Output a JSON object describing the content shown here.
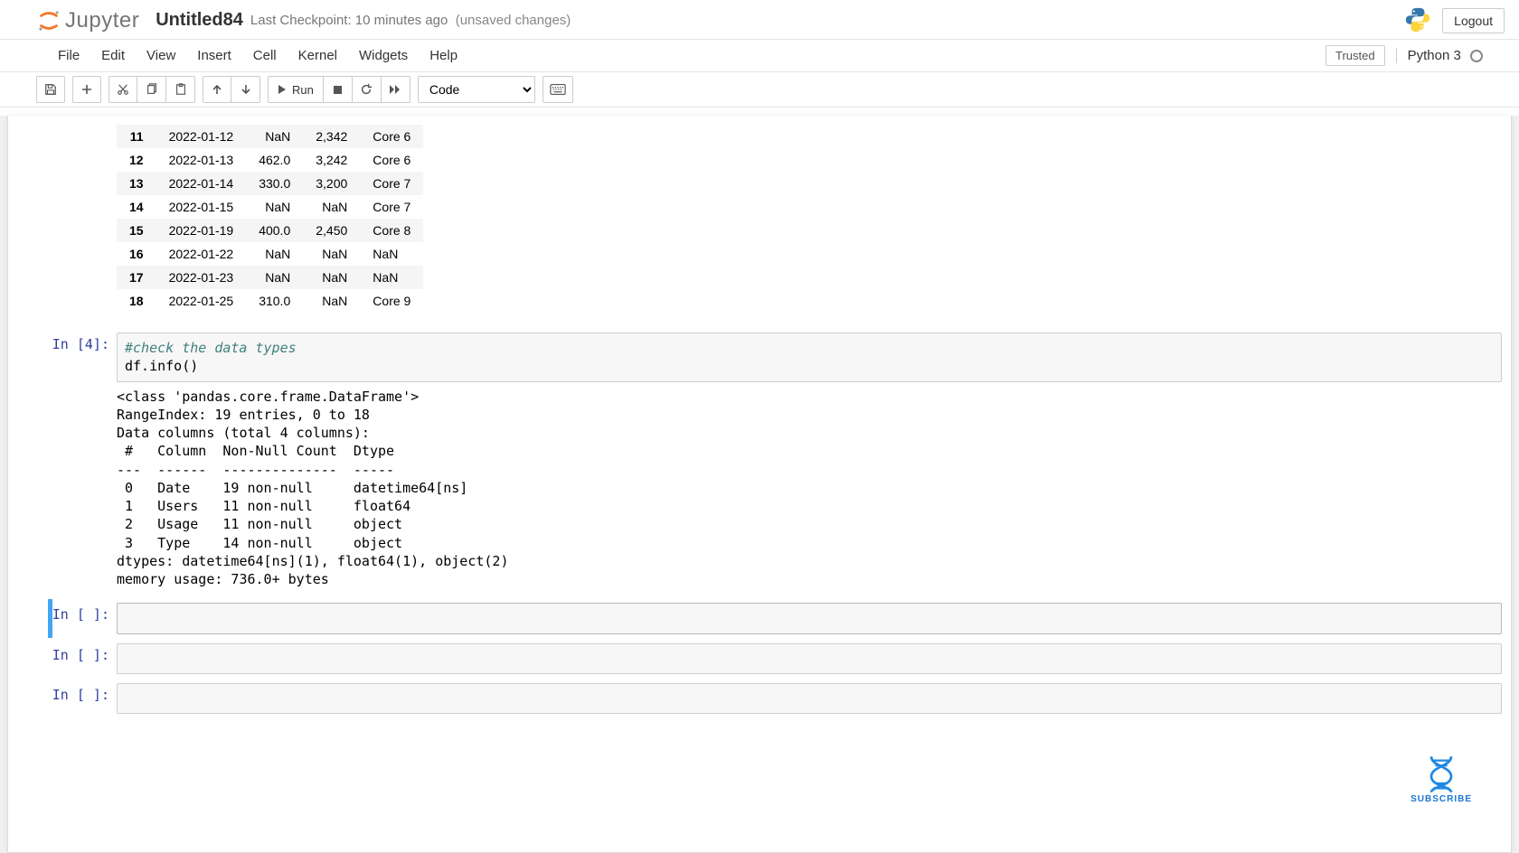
{
  "header": {
    "logo_text": "Jupyter",
    "title": "Untitled84",
    "checkpoint": "Last Checkpoint: 10 minutes ago",
    "unsaved": "(unsaved changes)",
    "logout": "Logout"
  },
  "menubar": {
    "items": [
      "File",
      "Edit",
      "View",
      "Insert",
      "Cell",
      "Kernel",
      "Widgets",
      "Help"
    ],
    "trusted": "Trusted",
    "kernel": "Python 3"
  },
  "toolbar": {
    "run_label": "Run",
    "cell_type_selected": "Code"
  },
  "cells": {
    "df_rows": [
      {
        "idx": "11",
        "date": "2022-01-12",
        "users": "NaN",
        "usage": "2,342",
        "type": "Core 6"
      },
      {
        "idx": "12",
        "date": "2022-01-13",
        "users": "462.0",
        "usage": "3,242",
        "type": "Core 6"
      },
      {
        "idx": "13",
        "date": "2022-01-14",
        "users": "330.0",
        "usage": "3,200",
        "type": "Core 7"
      },
      {
        "idx": "14",
        "date": "2022-01-15",
        "users": "NaN",
        "usage": "NaN",
        "type": "Core 7"
      },
      {
        "idx": "15",
        "date": "2022-01-19",
        "users": "400.0",
        "usage": "2,450",
        "type": "Core 8"
      },
      {
        "idx": "16",
        "date": "2022-01-22",
        "users": "NaN",
        "usage": "NaN",
        "type": "NaN"
      },
      {
        "idx": "17",
        "date": "2022-01-23",
        "users": "NaN",
        "usage": "NaN",
        "type": "NaN"
      },
      {
        "idx": "18",
        "date": "2022-01-25",
        "users": "310.0",
        "usage": "NaN",
        "type": "Core 9"
      }
    ],
    "cell4": {
      "prompt": "In [4]:",
      "code_comment": "#check the data types",
      "code_line": "df.info()",
      "output": "<class 'pandas.core.frame.DataFrame'>\nRangeIndex: 19 entries, 0 to 18\nData columns (total 4 columns):\n #   Column  Non-Null Count  Dtype\n---  ------  --------------  -----\n 0   Date    19 non-null     datetime64[ns]\n 1   Users   11 non-null     float64\n 2   Usage   11 non-null     object\n 3   Type    14 non-null     object\ndtypes: datetime64[ns](1), float64(1), object(2)\nmemory usage: 736.0+ bytes"
    },
    "empty_prompt": "In [ ]:"
  },
  "overlay": {
    "subscribe": "SUBSCRIBE"
  }
}
